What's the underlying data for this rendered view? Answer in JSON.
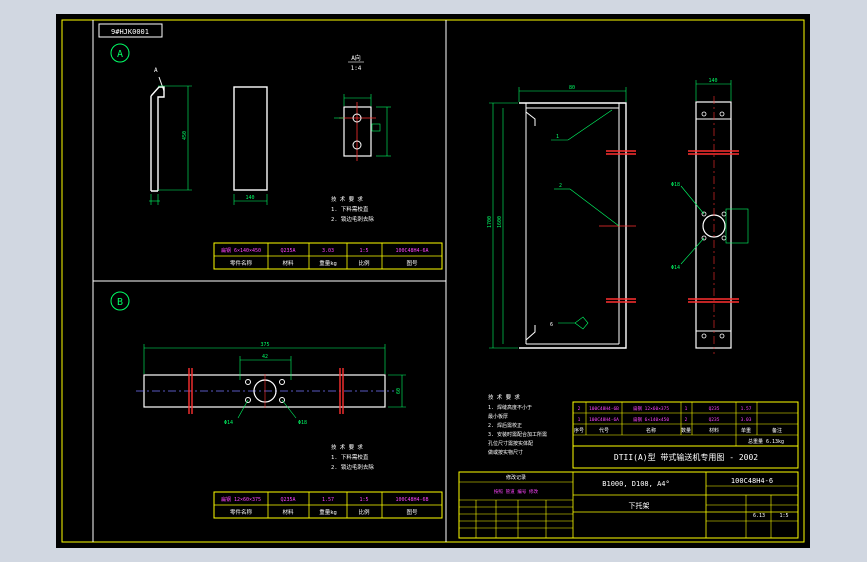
{
  "drawing_code": "9#HJK0001",
  "views": {
    "a": "A",
    "b": "B",
    "detail_title": "A向",
    "detail_scale": "1:4",
    "arrow_letter": "A"
  },
  "tech_req": {
    "title": "技 术 要 求",
    "left_line1": "1. 下料需校直",
    "left_line2": "2. 锁边毛刺去除",
    "right_lines": [
      "1. 焊缝高度不小于",
      "   最小板厚",
      "2. 焊后需校正",
      "3. 安装时需配合加工所需",
      "   孔位尺寸需按实体配",
      "   做或按实物尺寸"
    ]
  },
  "part_a": {
    "row": [
      "扁钢 6×140×450",
      "Q235A",
      "3.03",
      "1:5",
      "100C48H4-6A"
    ],
    "header": [
      "零件名称",
      "材料",
      "重量kg",
      "比例",
      "图号"
    ]
  },
  "part_b": {
    "row": [
      "扁钢 12×60×375",
      "Q235A",
      "1.57",
      "1:5",
      "100C48H4-6B"
    ],
    "header": [
      "零件名称",
      "材料",
      "重量kg",
      "比例",
      "图号"
    ]
  },
  "bom": {
    "rows": [
      [
        "2",
        "100C48H4-6B",
        "扁钢 12×60×375",
        "1",
        "Q235",
        "1.57",
        ""
      ],
      [
        "1",
        "100C48H4-6A",
        "扁钢 6×140×450",
        "2",
        "Q235",
        "3.03",
        ""
      ]
    ],
    "header": [
      "序号",
      "代号",
      "名称",
      "数量",
      "材料",
      "单重",
      "备注"
    ],
    "summary": "总重量 6.13kg",
    "title": "DTII(A)型 带式输送机专用图 - 2002",
    "spec": "B1000, D108, A4°",
    "drawing_no": "100C48H4-6",
    "part_name": "下托架",
    "scale": "1:5",
    "weight": "6.13"
  },
  "revision": {
    "title": "修改记录",
    "note": "按照 管道 编号 修改"
  },
  "dims": {
    "a1": "450",
    "a2": "140",
    "b1": "375",
    "b2": "60",
    "b3": "42",
    "front_w": "80",
    "front_h": "1700",
    "front_h2": "1600",
    "side_top": "140",
    "hole": "Φ18",
    "hole2": "Φ14",
    "weld": "6",
    "label1": "1",
    "label2": "2"
  }
}
